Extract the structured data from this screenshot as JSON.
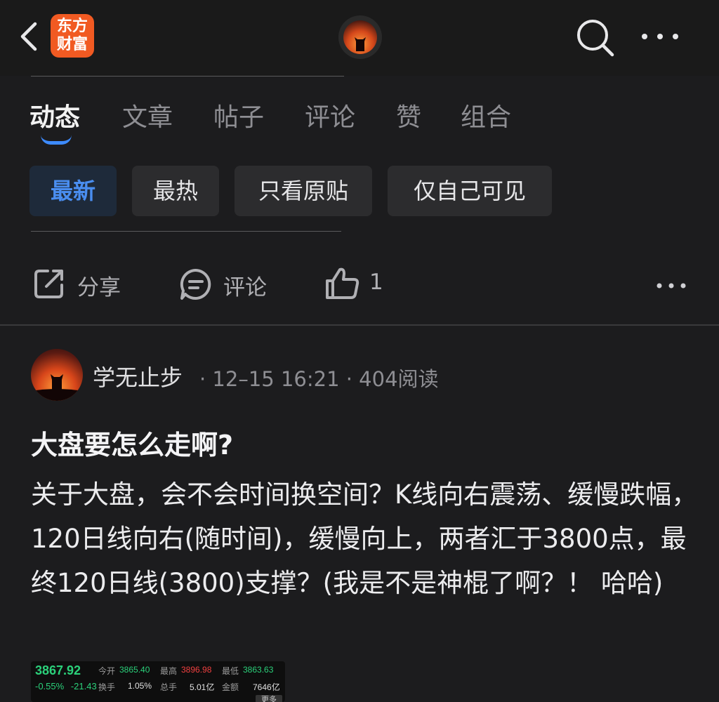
{
  "header": {
    "logo_line1": "东方",
    "logo_line2": "财富",
    "logo_color": "#f15a22",
    "icons": [
      "back-icon",
      "search-icon",
      "more-icon"
    ]
  },
  "tabs": [
    "动态",
    "文章",
    "帖子",
    "评论",
    "赞",
    "组合"
  ],
  "active_tab": "动态",
  "filters": [
    "最新",
    "最热",
    "只看原贴",
    "仅自己可见"
  ],
  "active_filter": "最新",
  "actions": {
    "share_label": "分享",
    "comment_label": "评论",
    "like_count": "1"
  },
  "post": {
    "author": "学无止步",
    "meta": "· 12–15 16:21 · 404阅读",
    "title": "大盘要怎么走啊?",
    "body": "关于大盘，会不会时间换空间？K线向右震荡、缓慢跌幅，120日线向右(随时间)，缓慢向上，两者汇于3800点，最终120日线(3800)支撑？(我是不是神棍了啊？！ 哈哈)"
  },
  "quote": {
    "price": "3867.92",
    "change_pct": "-0.55%",
    "change_abs": "-21.43",
    "open_label": "今开",
    "open": "3865.40",
    "high_label": "最高",
    "high": "3896.98",
    "low_label": "最低",
    "low": "3863.63",
    "turnover_label": "换手",
    "turnover": "1.05%",
    "volume_label": "总手",
    "volume": "5.01亿",
    "amount_label": "金额",
    "amount": "7646亿",
    "more_label": "更多"
  },
  "accent_color": "#3d8bff"
}
